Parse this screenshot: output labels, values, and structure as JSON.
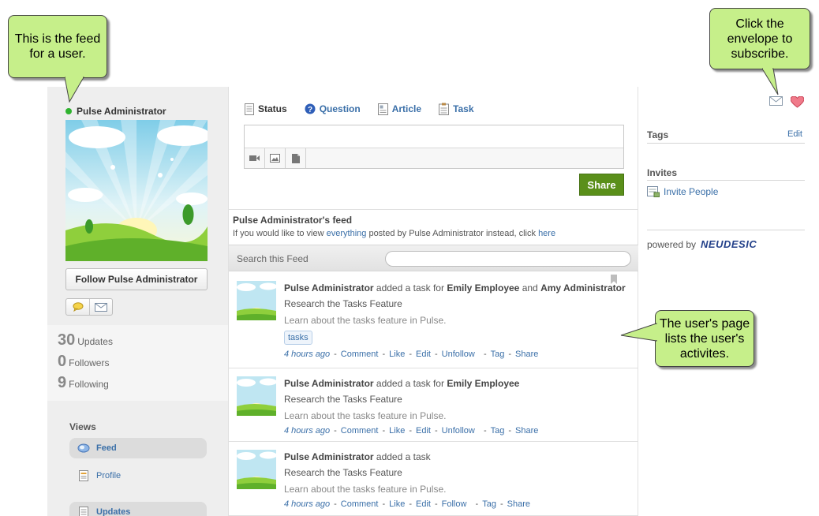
{
  "profile": {
    "name": "Pulse Administrator",
    "follow_label": "Follow Pulse Administrator",
    "stats": [
      {
        "num": "30",
        "label": "Updates"
      },
      {
        "num": "0",
        "label": "Followers"
      },
      {
        "num": "9",
        "label": "Following"
      }
    ]
  },
  "views": {
    "title": "Views",
    "items": [
      {
        "label": "Feed",
        "icon": "globe-icon"
      },
      {
        "label": "Profile",
        "icon": "document-icon"
      },
      {
        "label": "Updates",
        "icon": "document-icon"
      }
    ]
  },
  "composer": {
    "tabs": [
      {
        "label": "Status",
        "icon": "status-icon"
      },
      {
        "label": "Question",
        "icon": "question-icon"
      },
      {
        "label": "Article",
        "icon": "article-icon"
      },
      {
        "label": "Task",
        "icon": "task-icon"
      }
    ],
    "share_label": "Share"
  },
  "feed": {
    "title": "Pulse Administrator's feed",
    "sub_prefix": "If you would like to view ",
    "sub_link1": "everything",
    "sub_middle": " posted by Pulse Administrator instead, click ",
    "sub_link2": "here",
    "search_label": "Search this Feed",
    "items": [
      {
        "actor": "Pulse Administrator",
        "action": " added a task for ",
        "target1": "Emily Employee",
        "conj": " and ",
        "target2": "Amy Administrator",
        "title": "Research the Tasks Feature",
        "desc": "Learn about the tasks feature in Pulse.",
        "tag": "tasks",
        "time": "4 hours ago",
        "actions": [
          "Comment",
          "Like",
          "Edit",
          "Unfollow",
          "Tag",
          "Share"
        ]
      },
      {
        "actor": "Pulse Administrator",
        "action": " added a task for ",
        "target1": "Emily Employee",
        "title": "Research the Tasks Feature",
        "desc": "Learn about the tasks feature in Pulse.",
        "time": "4 hours ago",
        "actions": [
          "Comment",
          "Like",
          "Edit",
          "Unfollow",
          "Tag",
          "Share"
        ]
      },
      {
        "actor": "Pulse Administrator",
        "action": " added a task",
        "title": "Research the Tasks Feature",
        "desc": "Learn about the tasks feature in Pulse.",
        "time": "4 hours ago",
        "actions": [
          "Comment",
          "Like",
          "Edit",
          "Follow",
          "Tag",
          "Share"
        ]
      }
    ]
  },
  "right": {
    "tags_title": "Tags",
    "tags_edit": "Edit",
    "invites_title": "Invites",
    "invite_label": "Invite People",
    "powered_by": "powered by",
    "brand": "NEUDESIC"
  },
  "callouts": {
    "feed": "This is the feed for a user.",
    "envelope": "Click the envelope to subscribe.",
    "activities": "The user's page lists the user's activites."
  },
  "colors": {
    "accent": "#3a6fa8",
    "share_green": "#5a8f1a",
    "callout_green": "#c6ef8a",
    "online": "#2fb32f"
  }
}
